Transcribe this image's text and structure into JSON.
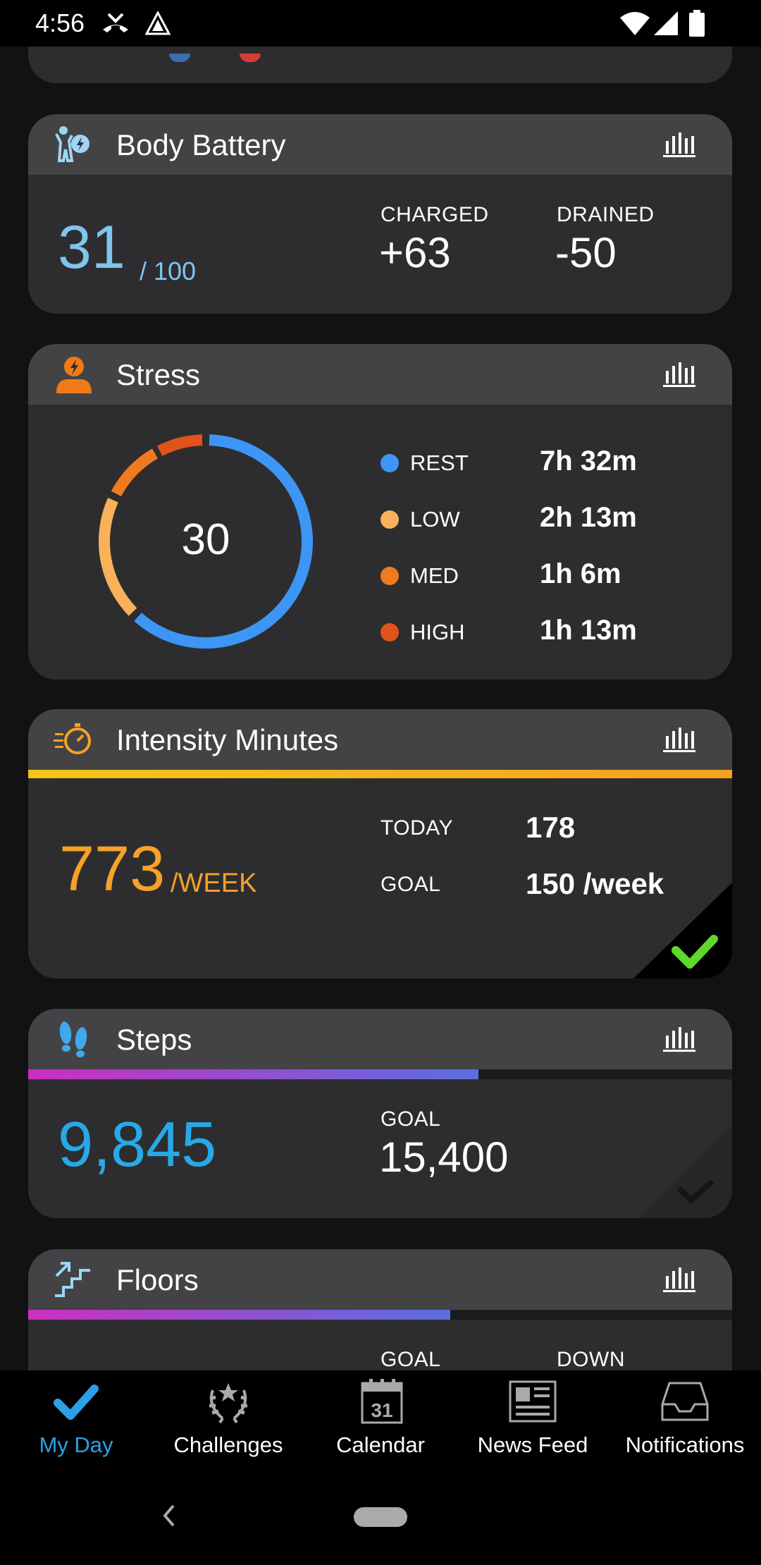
{
  "status_bar": {
    "time": "4:56"
  },
  "body_battery": {
    "title": "Body Battery",
    "value": "31",
    "max": "/ 100",
    "charged_label": "CHARGED",
    "charged_value": "+63",
    "drained_label": "DRAINED",
    "drained_value": "-50"
  },
  "stress": {
    "title": "Stress",
    "value": "30",
    "levels": [
      {
        "label": "REST",
        "duration": "7h 32m",
        "color": "#3d96f5"
      },
      {
        "label": "LOW",
        "duration": "2h 13m",
        "color": "#f9b15a"
      },
      {
        "label": "MED",
        "duration": "1h 6m",
        "color": "#ef7a1f"
      },
      {
        "label": "HIGH",
        "duration": "1h 13m",
        "color": "#e0531b"
      }
    ]
  },
  "intensity": {
    "title": "Intensity Minutes",
    "value": "773",
    "unit": "/WEEK",
    "today_label": "TODAY",
    "today_value": "178",
    "goal_label": "GOAL",
    "goal_value": "150 /week",
    "goal_met": true
  },
  "steps": {
    "title": "Steps",
    "value": "9,845",
    "goal_label": "GOAL",
    "goal_value": "15,400",
    "progress": 0.64
  },
  "floors": {
    "title": "Floors",
    "goal_label": "GOAL",
    "down_label": "DOWN",
    "progress": 0.6
  },
  "bottom_nav": {
    "items": [
      {
        "label": "My Day",
        "active": true
      },
      {
        "label": "Challenges"
      },
      {
        "label": "Calendar"
      },
      {
        "label": "News Feed"
      },
      {
        "label": "Notifications"
      }
    ],
    "calendar_day": "31"
  },
  "colors": {
    "accent_blue": "#2aa0e8",
    "intensity_orange": "#f7a12a",
    "battery_blue": "#7fc5ee",
    "steps_blue": "#27a9e8",
    "check_green": "#5fd72b"
  }
}
